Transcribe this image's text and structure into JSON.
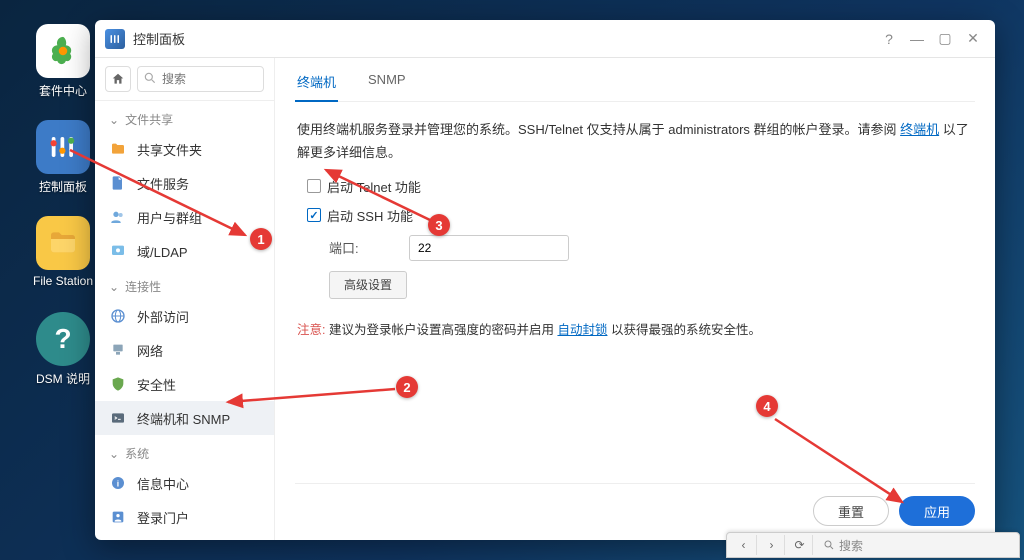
{
  "desktop": [
    {
      "label": "套件中心",
      "color": "#fff"
    },
    {
      "label": "控制面板",
      "color": "#3d7bc7"
    },
    {
      "label": "File Station",
      "color": "#f9c846"
    },
    {
      "label": "DSM 说明",
      "color": "#2e8b8b"
    }
  ],
  "window": {
    "title": "控制面板"
  },
  "sidebar": {
    "search_placeholder": "搜索",
    "sections": {
      "file_sharing": "文件共享",
      "connectivity": "连接性",
      "system": "系统"
    },
    "items": {
      "shared_folder": "共享文件夹",
      "file_services": "文件服务",
      "user_group": "用户与群组",
      "domain_ldap": "域/LDAP",
      "external_access": "外部访问",
      "network": "网络",
      "security": "安全性",
      "terminal_snmp": "终端机和 SNMP",
      "info_center": "信息中心",
      "login_portal": "登录门户"
    }
  },
  "tabs": {
    "terminal": "终端机",
    "snmp": "SNMP"
  },
  "content": {
    "desc_pre": "使用终端机服务登录并管理您的系统。SSH/Telnet 仅支持从属于 administrators 群组的帐户登录。请参阅 ",
    "desc_link": "终端机",
    "desc_post": " 以了解更多详细信息。",
    "enable_telnet": "启动 Telnet 功能",
    "enable_ssh": "启动 SSH 功能",
    "port_label": "端口:",
    "port_value": "22",
    "advanced": "高级设置",
    "note_label": "注意:",
    "note_text": "建议为登录帐户设置高强度的密码并启用 ",
    "note_link": "自动封锁",
    "note_after": " 以获得最强的系统安全性。"
  },
  "footer": {
    "reset": "重置",
    "apply": "应用"
  },
  "taskbar": {
    "search": "搜索"
  },
  "annos": [
    "1",
    "2",
    "3",
    "4"
  ]
}
